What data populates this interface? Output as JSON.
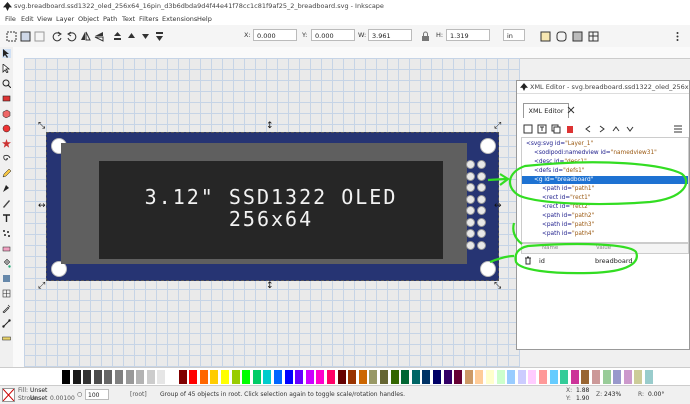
{
  "window": {
    "title": "svg.breadboard.ssd1322_oled_256x64_16pin_d3b6dbda9d4f44e41f78cc1c81f9af25_2_breadboard.svg - Inkscape"
  },
  "menu": [
    "File",
    "Edit",
    "View",
    "Layer",
    "Object",
    "Path",
    "Text",
    "Filters",
    "Extensions",
    "Help"
  ],
  "toolbar": {
    "x_label": "X:",
    "x_value": "0.000",
    "y_label": "Y:",
    "y_value": "0.000",
    "w_label": "W:",
    "w_value": "3.961",
    "h_label": "H:",
    "h_value": "1.319",
    "unit": "in"
  },
  "canvas": {
    "display_line1": "3.12\" SSD1322 OLED",
    "display_line2": "256x64"
  },
  "xml_editor": {
    "window_title": "XML Editor - svg.breadboard.ssd1322_oled_256x64_16p...",
    "tab_label": "XML Editor",
    "nodes": [
      {
        "tag": "<svg:svg id=",
        "val": "\"Layer_1\""
      },
      {
        "tag": "<sodipodi:namedview id=",
        "val": "\"namedview31\""
      },
      {
        "tag": "<desc id=",
        "val": "\"desc1\""
      },
      {
        "tag": "<defs id=",
        "val": "\"defs1\""
      },
      {
        "tag": "<g id=",
        "val": "\"breadboard\""
      },
      {
        "tag": "<path id=",
        "val": "\"path1\""
      },
      {
        "tag": "<rect id=",
        "val": "\"rect1\""
      },
      {
        "tag": "<rect id=",
        "val": "\"rect2\""
      },
      {
        "tag": "<path id=",
        "val": "\"path2\""
      },
      {
        "tag": "<path id=",
        "val": "\"path3\""
      },
      {
        "tag": "<path id=",
        "val": "\"path4\""
      }
    ],
    "attr_header_name": "Name",
    "attr_header_value": "Value",
    "attr_name": "id",
    "attr_value": "breadboard"
  },
  "status": {
    "fill_label": "Fill:",
    "fill_value": "Unset",
    "stroke_label": "Stroke:",
    "stroke_value": "Unset",
    "stroke_width": "0.00100",
    "opacity": "100",
    "layer": "[root]",
    "message": "Group of 45 objects in root. Click selection again to toggle scale/rotation handles.",
    "cursor_x_label": "X:",
    "cursor_x": "1.88",
    "cursor_y_label": "Y:",
    "cursor_y": "1.90",
    "zoom_label": "Z:",
    "zoom": "243%",
    "rotation_label": "R:",
    "rotation": "0.00°"
  },
  "colors": {
    "board": "#263473",
    "glass": "#5f5f5f",
    "screen": "#262626",
    "annotation": "#33dd22",
    "selected_row": "#1e72d2"
  }
}
